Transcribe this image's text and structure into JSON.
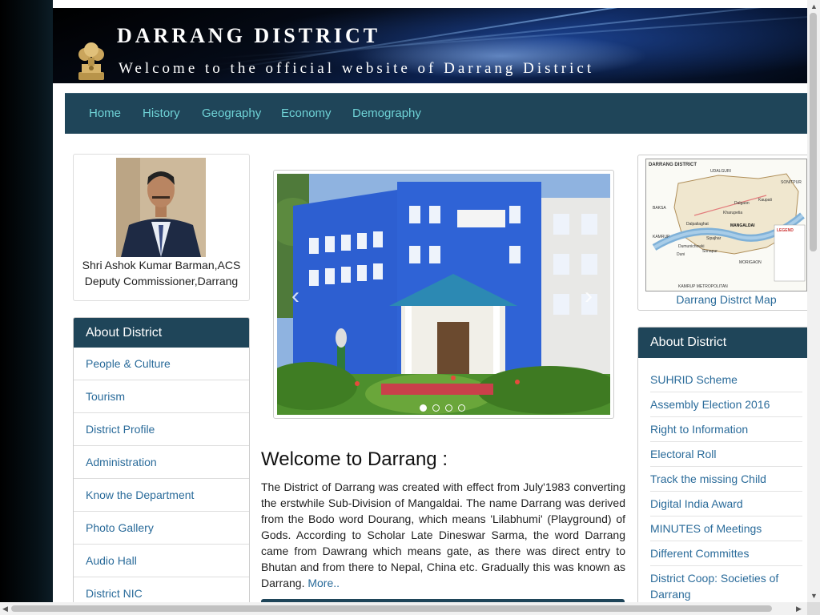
{
  "header": {
    "title": "DARRANG DISTRICT",
    "subtitle": "Welcome to the official website of Darrang District"
  },
  "nav": {
    "items": [
      "Home",
      "History",
      "Geography",
      "Economy",
      "Demography"
    ]
  },
  "profile": {
    "name": "Shri Ashok Kumar Barman,ACS",
    "designation": "Deputy Commissioner,Darrang"
  },
  "left_panel": {
    "heading": "About District",
    "items": [
      "People & Culture",
      "Tourism",
      "District Profile",
      "Administration",
      "Know the Department",
      "Photo Gallery",
      "Audio Hall",
      "District NIC"
    ]
  },
  "carousel": {
    "prev_glyph": "‹",
    "next_glyph": "›",
    "dots": 4,
    "active_index": 0
  },
  "welcome": {
    "heading": "Welcome to Darrang :",
    "body": "The District of Darrang was created with effect from July'1983 converting the erstwhile Sub-Division of Mangaldai. The name Darrang was derived from the Bodo word Dourang, which means 'Lilabhumi' (Playground) of Gods. According to Scholar Late Dineswar Sarma, the word Darrang came from Dawrang which means gate, as there was direct entry to Bhutan and from there to Nepal, China etc. Gradually this was known as Darrang.",
    "more_link": "More.."
  },
  "map": {
    "caption": "Darrang Distrct Map",
    "label_title": "DARRANG DISTRICT",
    "places": [
      "UDALGURI",
      "SONITPUR",
      "BAKSA",
      "Dalgaon",
      "Kaupati",
      "Kharupetia",
      "MANGALDAI",
      "Dalpaliaghat",
      "Sipajhar",
      "KAMRUP",
      "Duni",
      "Dumunichowki",
      "Sonapur",
      "MORIGAON",
      "KAMRUP METROPOLITAN"
    ],
    "legend_title": "LEGEND"
  },
  "right_panel": {
    "heading": "About District",
    "items": [
      "SUHRID Scheme",
      "Assembly Election 2016",
      "Right to Information",
      "Electoral Roll",
      "Track the missing Child",
      "Digital India Award",
      "MINUTES of Meetings",
      "Different Committes",
      "District Coop: Societies of Darrang"
    ]
  },
  "colors": {
    "nav_bg": "#1f4559",
    "nav_link": "#6fd2d6",
    "link": "#2a6b9a",
    "panel_head_bg": "#1f4559"
  }
}
